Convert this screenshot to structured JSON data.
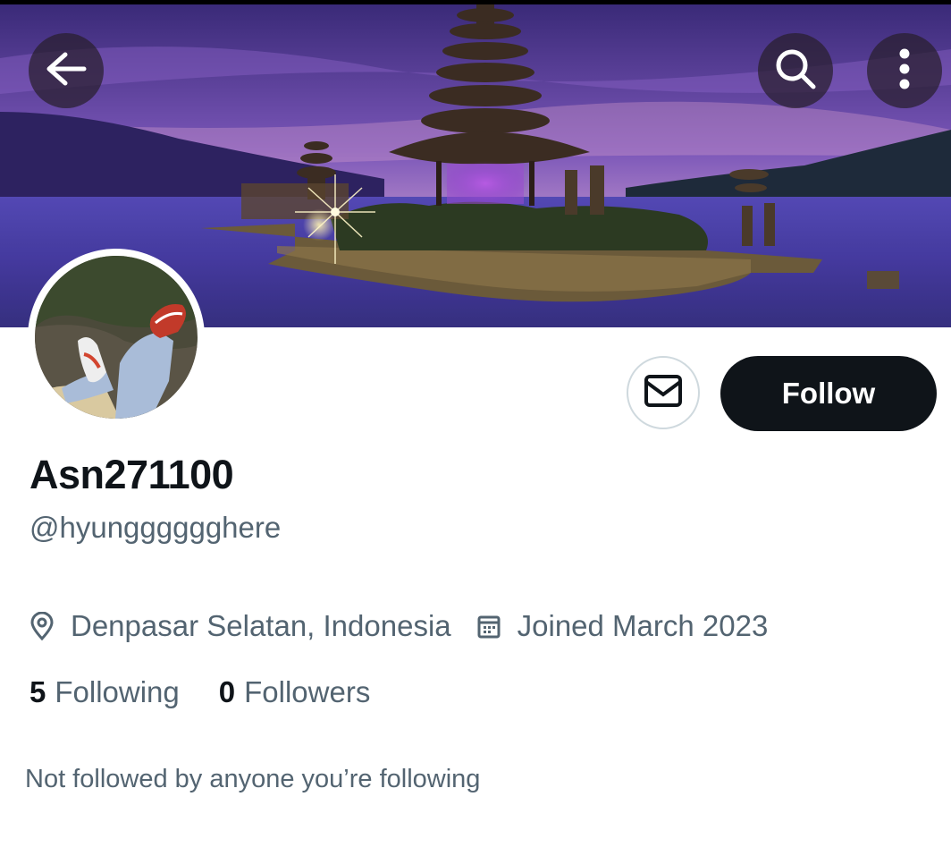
{
  "header": {
    "back_icon": "arrow-left-icon",
    "search_icon": "search-icon",
    "more_icon": "more-vertical-icon"
  },
  "profile": {
    "display_name": "Asn271100",
    "handle": "@hyungggggghere",
    "location": "Denpasar Selatan, Indonesia",
    "joined": "Joined March 2023",
    "following_count": "5",
    "following_label": "Following",
    "followers_count": "0",
    "followers_label": "Followers",
    "mutuals_note": "Not followed by anyone you’re following"
  },
  "actions": {
    "message_icon": "mail-icon",
    "follow_label": "Follow"
  },
  "colors": {
    "primary_text": "#0f1419",
    "secondary_text": "#536471",
    "follow_bg": "#0f1419",
    "border": "#cfd9de"
  }
}
